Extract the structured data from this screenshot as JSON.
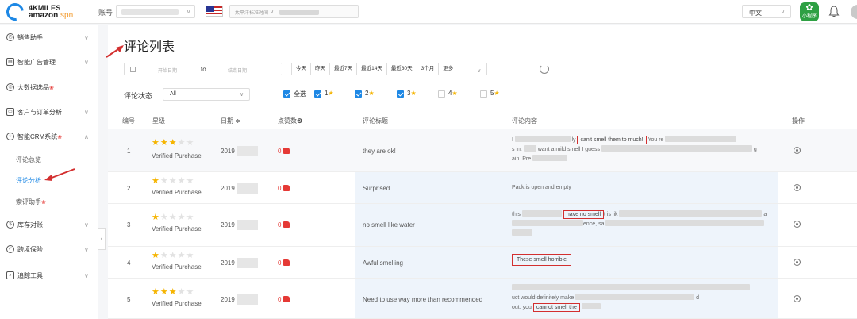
{
  "header": {
    "logo_line1": "4KMILES",
    "logo_line2a": "amazon",
    "logo_line2b": "spn",
    "account_label": "账号",
    "timezone_text": "太平洋标准时间",
    "language": "中文",
    "mini_program": "小程序"
  },
  "sidebar": {
    "items": [
      {
        "label": "销售助手",
        "icon": "sales-icon"
      },
      {
        "label": "智能广告管理",
        "icon": "ad-icon"
      },
      {
        "label": "大数据选品",
        "icon": "data-icon",
        "hot": true
      },
      {
        "label": "客户与订单分析",
        "icon": "order-icon"
      },
      {
        "label": "智能CRM系统",
        "icon": "crm-icon",
        "hot": true
      },
      {
        "label": "库存对账",
        "icon": "inventory-icon"
      },
      {
        "label": "跨境保险",
        "icon": "insurance-icon"
      },
      {
        "label": "追踪工具",
        "icon": "tracking-icon"
      }
    ],
    "crm_sub": [
      "评论总览",
      "评论分析",
      "索评助手"
    ],
    "hot_mark": "❀"
  },
  "page": {
    "title": "评论列表",
    "date_start_ph": "开始日期",
    "date_to": "to",
    "date_end_ph": "结束日期",
    "quick_ranges": [
      "今天",
      "昨天",
      "最近7天",
      "最近14天",
      "最近30天",
      "3个月"
    ],
    "more": "更多",
    "status_label": "评论状态",
    "status_value": "All",
    "select_all": "全选",
    "star_filters": [
      "1",
      "2",
      "3",
      "4",
      "5"
    ]
  },
  "table": {
    "headers": [
      "编号",
      "星级",
      "日期 ≑",
      "点赞数❷",
      "评论标题",
      "评论内容",
      "操作"
    ],
    "verified": "Verified Purchase",
    "rows": [
      {
        "num": "1",
        "stars": 3,
        "date": "2019",
        "likes": "0",
        "title": "they are ok!",
        "highlight": "can't smell them to much!"
      },
      {
        "num": "2",
        "stars": 1,
        "date": "2019",
        "likes": "0",
        "title": "Surprised",
        "content": "Pack is open and empty"
      },
      {
        "num": "3",
        "stars": 1,
        "date": "2019",
        "likes": "0",
        "title": "no smell like water",
        "highlight": "have no smell"
      },
      {
        "num": "4",
        "stars": 1,
        "date": "2019",
        "likes": "0",
        "title": "Awful smelling",
        "highlight": "These smell horrible"
      },
      {
        "num": "5",
        "stars": 3,
        "date": "2019",
        "likes": "0",
        "title": "Need to use way more than recommended",
        "highlight": "cannot smell the"
      }
    ],
    "r1_frag": [
      "I",
      "lly",
      "You re",
      "s in. ",
      "want a mild smell I guess",
      "ain. Pre"
    ],
    "r3_frag": [
      "this",
      "t is lik",
      "a",
      "ence, sa"
    ],
    "r5_frag": [
      "uct would definitely make",
      "d",
      "out, you"
    ]
  },
  "colors": {
    "accent": "#1e88e5",
    "highlight_box": "#d32f2f",
    "star": "#f5b400",
    "like": "#e53935"
  }
}
